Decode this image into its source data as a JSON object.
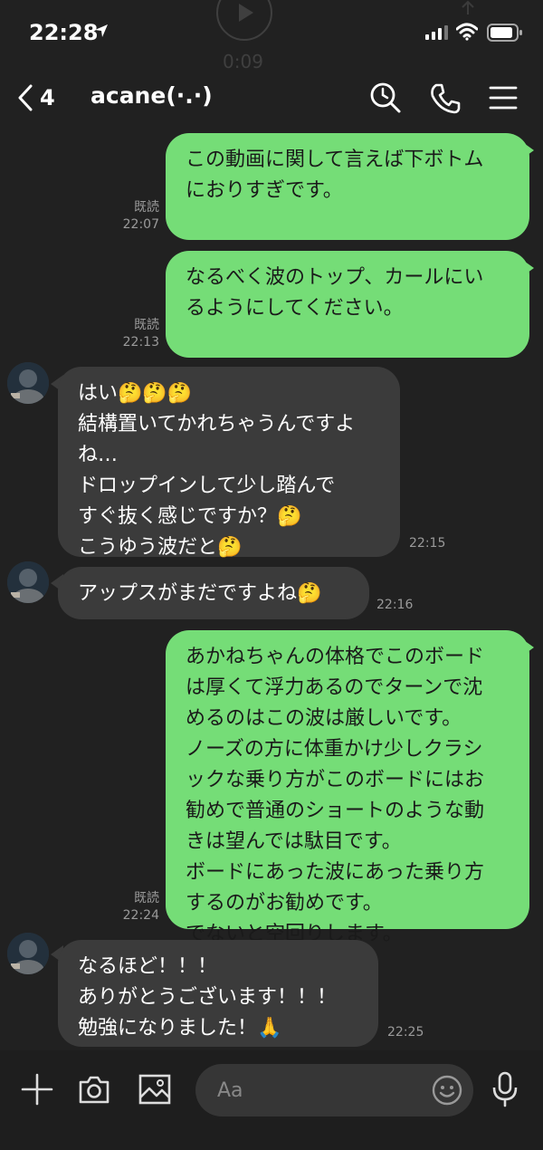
{
  "status_bar": {
    "time": "22:28"
  },
  "ghost_overlay": {
    "video_time": "0:09"
  },
  "header": {
    "back_count": "4",
    "title": "acane(·.·)"
  },
  "messages": [
    {
      "direction": "out",
      "text": "この動画に関して言えば下ボトム\nにおりすぎです。",
      "read_label": "既読",
      "time": "22:07"
    },
    {
      "direction": "out",
      "text": "なるべく波のトップ、カールにい\nるようにしてください。",
      "read_label": "既読",
      "time": "22:13"
    },
    {
      "direction": "in",
      "text": "はい🤔🤔🤔\n結構置いてかれちゃうんですよ\nね…\nドロップインして少し踏んで\nすぐ抜く感じですか？🤔\nこうゆう波だと🤔",
      "time": "22:15"
    },
    {
      "direction": "in",
      "text": "アップスがまだですよね🤔",
      "time": "22:16"
    },
    {
      "direction": "out",
      "text": "あかねちゃんの体格でこのボード\nは厚くて浮力あるのでターンで沈\nめるのはこの波は厳しいです。\nノーズの方に体重かけ少しクラシ\nックな乗り方がこのボードにはお\n勧めで普通のショートのような動\nきは望んでは駄目です。\nボードにあった波にあった乗り方\nするのがお勧めです。\nでないと空回りします。",
      "read_label": "既読",
      "time": "22:24"
    },
    {
      "direction": "in",
      "text": "なるほど！！！\nありがとうございます！！！\n勉強になりました！🙏",
      "time": "22:25"
    }
  ],
  "input_bar": {
    "placeholder": "Aa"
  },
  "colors": {
    "background": "#212121",
    "outgoing_bubble": "#75dd77",
    "incoming_bubble": "#3b3b3b",
    "meta_text": "#9a9a9a"
  }
}
